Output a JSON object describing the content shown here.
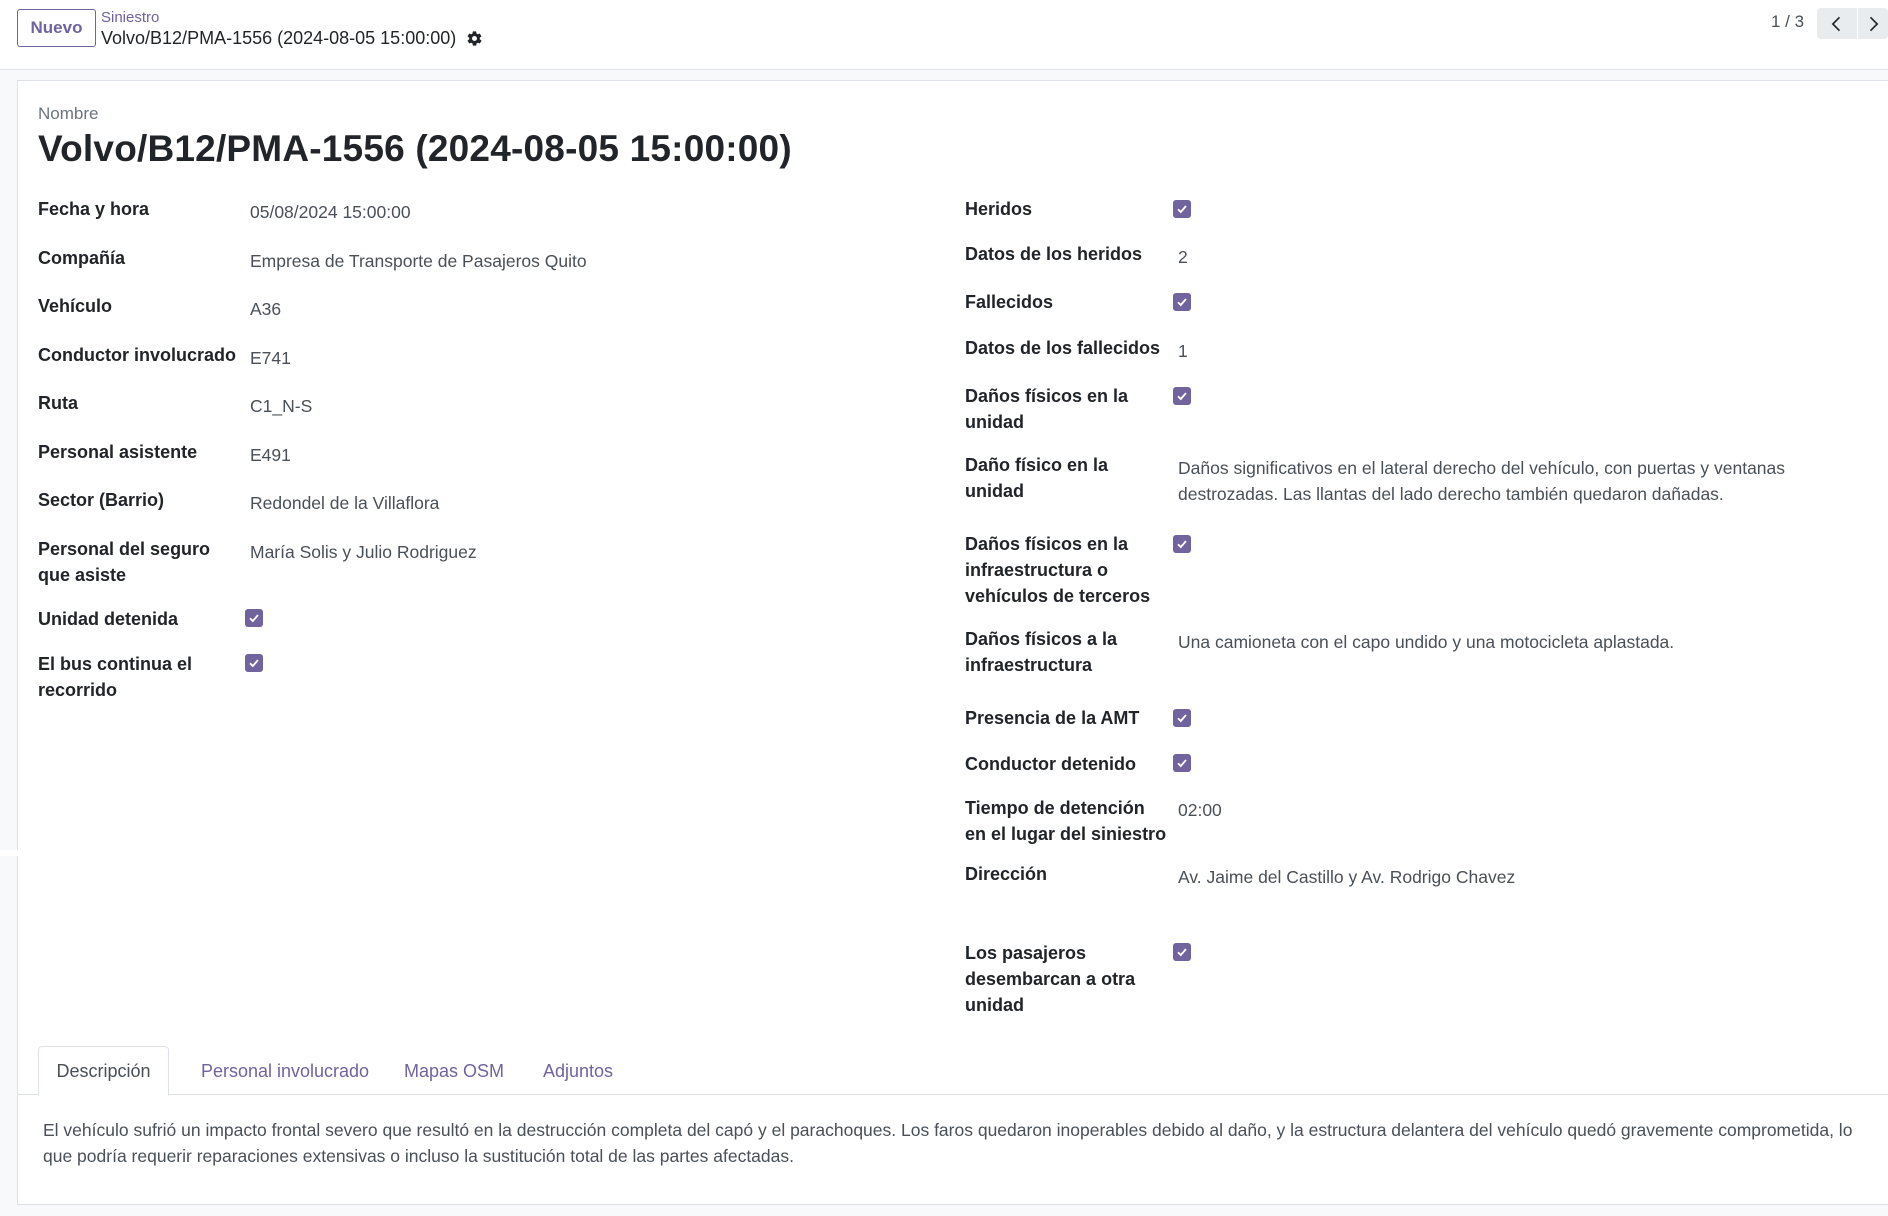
{
  "control_panel": {
    "new_button": "Nuevo",
    "breadcrumb_parent": "Siniestro",
    "breadcrumb_current": "Volvo/B12/PMA-1556 (2024-08-05 15:00:00)",
    "pager_value": "1 / 3"
  },
  "form": {
    "name_label": "Nombre",
    "name_value": "Volvo/B12/PMA-1556 (2024-08-05 15:00:00)",
    "left": {
      "fecha_label": "Fecha y hora",
      "fecha_value": "05/08/2024 15:00:00",
      "compania_label": "Compañía",
      "compania_value": "Empresa de Transporte de Pasajeros Quito",
      "vehiculo_label": "Vehículo",
      "vehiculo_value": "A36",
      "conductor_label": "Conductor involucrado",
      "conductor_value": "E741",
      "ruta_label": "Ruta",
      "ruta_value": "C1_N-S",
      "asistente_label": "Personal asistente",
      "asistente_value": "E491",
      "sector_label": "Sector (Barrio)",
      "sector_value": "Redondel de  la Villaflora",
      "seguro_label_1": "Personal del seguro",
      "seguro_label_2": "que asiste",
      "seguro_value": "María Solis y Julio Rodriguez",
      "detenida_label": "Unidad detenida",
      "continua_label_1": "El bus continua el",
      "continua_label_2": "recorrido"
    },
    "right": {
      "heridos_label": "Heridos",
      "datos_heridos_label": "Datos de los heridos",
      "datos_heridos_value": "2",
      "fallecidos_label": "Fallecidos",
      "datos_fallecidos_label": "Datos de los fallecidos",
      "datos_fallecidos_value": "1",
      "danos_unidad_label_1": "Daños físicos en la",
      "danos_unidad_label_2": "unidad",
      "dano_unidad_label_1": "Daño físico en la",
      "dano_unidad_label_2": "unidad",
      "dano_unidad_value_1": "Daños significativos en el lateral derecho del vehículo, con puertas y ventanas",
      "dano_unidad_value_2": "destrozadas. Las llantas del lado derecho también quedaron dañadas.",
      "danos_terceros_label_1": "Daños físicos en la",
      "danos_terceros_label_2": "infraestructura o",
      "danos_terceros_label_3": "vehículos de terceros",
      "danos_infra_label_1": "Daños físicos a la",
      "danos_infra_label_2": "infraestructura",
      "danos_infra_value": "Una camioneta con el capo undido y una motocicleta aplastada.",
      "amt_label": "Presencia de la AMT",
      "conductor_detenido_label": "Conductor detenido",
      "tiempo_label_1": "Tiempo de detención",
      "tiempo_label_2": "en el lugar del siniestro",
      "tiempo_value": "02:00",
      "direccion_label": "Dirección",
      "direccion_value": "Av. Jaime del Castillo y Av. Rodrigo Chavez",
      "pasajeros_label_1": "Los pasajeros",
      "pasajeros_label_2": "desembarcan a otra",
      "pasajeros_label_3": "unidad"
    }
  },
  "tabs": [
    "Descripción",
    "Personal involucrado",
    "Mapas OSM",
    "Adjuntos"
  ],
  "description_1": "El vehículo sufrió un impacto frontal severo que resultó en la destrucción completa del capó y el parachoques. Los faros quedaron inoperables debido al daño, y la estructura delantera del vehículo quedó gravemente comprometida, lo",
  "description_2": "que podría requerir reparaciones extensivas o incluso la sustitución total de las partes afectadas.",
  "colors": {
    "primary": "#71639e",
    "text": "#212529",
    "muted": "#495057"
  }
}
